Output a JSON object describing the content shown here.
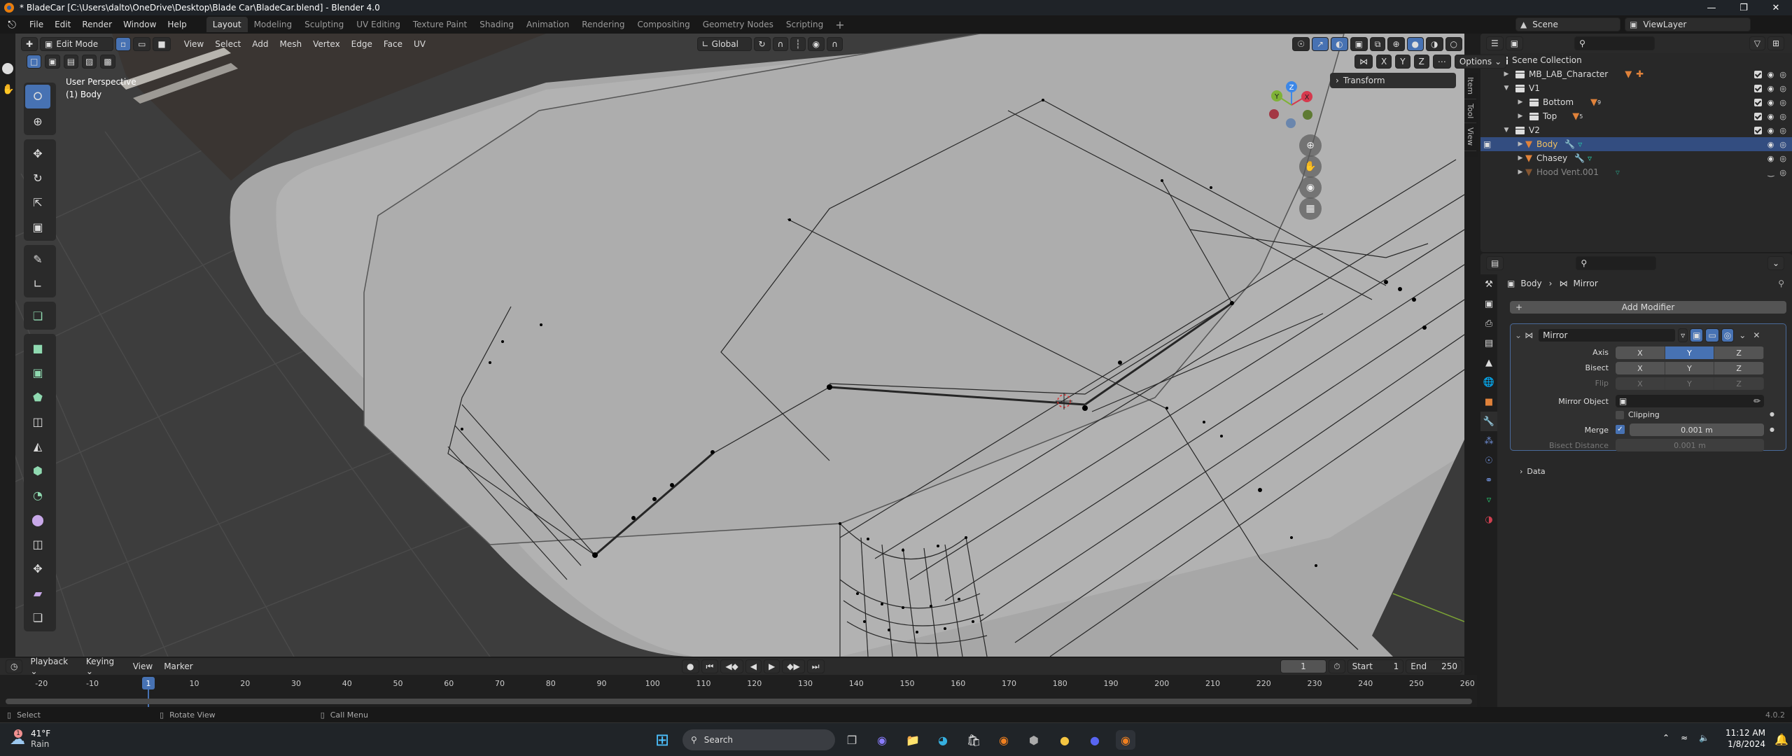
{
  "window": {
    "title": "* BladeCar [C:\\Users\\dalto\\OneDrive\\Desktop\\Blade Car\\BladeCar.blend] - Blender 4.0",
    "controls": [
      "minimize",
      "maximize",
      "close"
    ]
  },
  "menubar": {
    "menus": [
      "File",
      "Edit",
      "Render",
      "Window",
      "Help"
    ],
    "workspaces": [
      "Layout",
      "Modeling",
      "Sculpting",
      "UV Editing",
      "Texture Paint",
      "Shading",
      "Animation",
      "Rendering",
      "Compositing",
      "Geometry Nodes",
      "Scripting"
    ],
    "active_workspace": "Layout",
    "add_workspace": "+"
  },
  "scene_selector": {
    "scene": "Scene",
    "view_layer": "ViewLayer"
  },
  "viewport": {
    "mode": "Edit Mode",
    "menus": [
      "View",
      "Select",
      "Add",
      "Mesh",
      "Vertex",
      "Edge",
      "Face",
      "UV"
    ],
    "transform_orientation": "Global",
    "view_name": "User Perspective",
    "object_info": "(1) Body",
    "mirror_axes": [
      "X",
      "Y",
      "Z"
    ],
    "options_label": "Options",
    "transform_panel": "Transform",
    "side_tabs": [
      "Item",
      "Tool",
      "View"
    ],
    "gizmo_axes": {
      "x": "X",
      "y": "Y",
      "z": "Z"
    },
    "colors": {
      "x": "#d6394d",
      "y": "#7fb236",
      "z": "#3c87e8",
      "select_blue": "#4772b3"
    }
  },
  "outliner": {
    "root": "Scene Collection",
    "rows": [
      {
        "name": "MB_LAB_Character",
        "depth": 1,
        "type": "collection",
        "expanded": false,
        "badges": [
          "mesh",
          "armature"
        ]
      },
      {
        "name": "V1",
        "depth": 1,
        "type": "collection",
        "expanded": true,
        "badges": []
      },
      {
        "name": "Bottom",
        "depth": 2,
        "type": "collection",
        "expanded": false,
        "badges": [
          "mesh"
        ],
        "count": "9"
      },
      {
        "name": "Top",
        "depth": 2,
        "type": "collection",
        "expanded": false,
        "badges": [
          "mesh"
        ],
        "count": "5"
      },
      {
        "name": "V2",
        "depth": 1,
        "type": "collection",
        "expanded": true,
        "badges": []
      },
      {
        "name": "Body",
        "depth": 2,
        "type": "mesh",
        "expanded": false,
        "selected": true,
        "badges": [
          "modifier",
          "mesh-data"
        ]
      },
      {
        "name": "Chasey",
        "depth": 2,
        "type": "mesh",
        "expanded": false,
        "badges": [
          "modifier",
          "mesh-data"
        ]
      },
      {
        "name": "Hood Vent.001",
        "depth": 2,
        "type": "mesh",
        "expanded": false,
        "hidden": true,
        "badges": [
          "mesh-data"
        ]
      }
    ]
  },
  "properties": {
    "breadcrumb": [
      "Body",
      "Mirror"
    ],
    "add_modifier": "Add Modifier",
    "modifier": {
      "name": "Mirror",
      "axis_label": "Axis",
      "bisect_label": "Bisect",
      "flip_label": "Flip",
      "axes": [
        "X",
        "Y",
        "Z"
      ],
      "axis_active": "Y",
      "mirror_object_label": "Mirror Object",
      "mirror_object_value": "",
      "clipping_label": "Clipping",
      "clipping": false,
      "merge_label": "Merge",
      "merge_enabled": true,
      "merge_value": "0.001 m",
      "bisect_distance_label": "Bisect Distance",
      "bisect_distance_value": "0.001 m",
      "data_label": "Data"
    }
  },
  "timeline": {
    "menus": [
      "Playback",
      "Keying",
      "View",
      "Marker"
    ],
    "current_frame": "1",
    "start_label": "Start",
    "start": "1",
    "end_label": "End",
    "end": "250",
    "ticks": [
      "-20",
      "-10",
      "10",
      "20",
      "30",
      "40",
      "50",
      "60",
      "70",
      "80",
      "90",
      "100",
      "110",
      "120",
      "130",
      "140",
      "150",
      "160",
      "170",
      "180",
      "190",
      "200",
      "210",
      "220",
      "230",
      "240",
      "250",
      "260"
    ],
    "playhead": "1"
  },
  "statusbar": {
    "hints": [
      "Select",
      "Rotate View",
      "Call Menu"
    ],
    "version": "4.0.2"
  },
  "taskbar": {
    "weather_temp": "41°F",
    "weather_desc": "Rain",
    "weather_badge": "1",
    "search_placeholder": "Search",
    "time": "11:12 AM",
    "date": "1/8/2024"
  }
}
